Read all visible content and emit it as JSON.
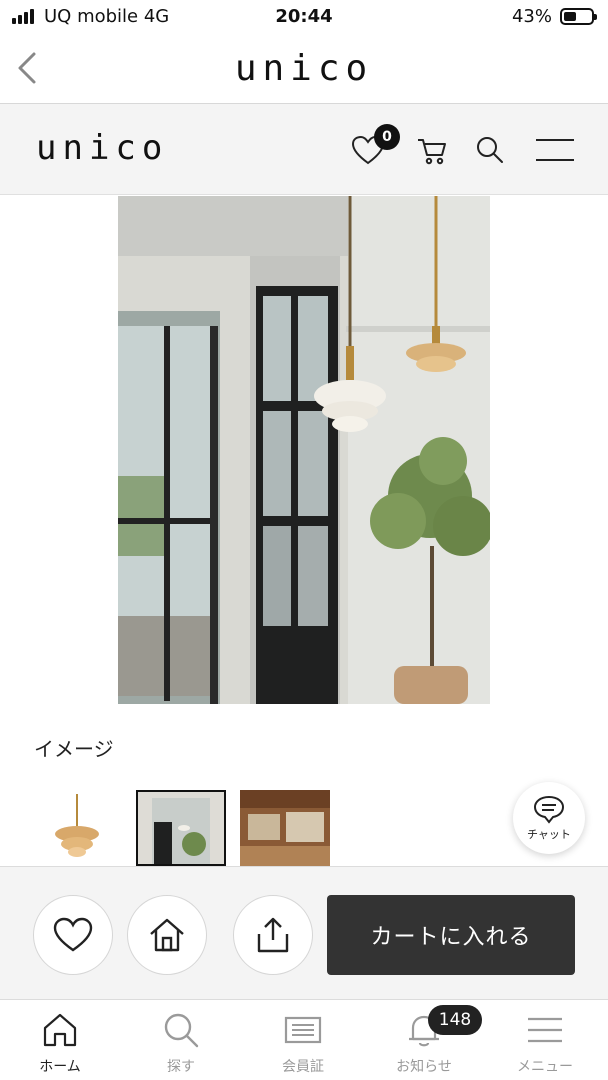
{
  "status_bar": {
    "carrier": "UQ mobile  4G",
    "time": "20:44",
    "battery": "43%"
  },
  "app_header": {
    "title": "unico"
  },
  "site_header": {
    "logo": "unico",
    "favorites_count": "0"
  },
  "product": {
    "image_caption": "イメージ"
  },
  "chat": {
    "label": "チャット"
  },
  "actions": {
    "cart_label": "カートに入れる"
  },
  "tab_bar": {
    "items": [
      {
        "label": "ホーム",
        "icon": "home-icon"
      },
      {
        "label": "探す",
        "icon": "search-icon"
      },
      {
        "label": "会員証",
        "icon": "member-card-icon"
      },
      {
        "label": "お知らせ",
        "icon": "bell-icon"
      },
      {
        "label": "メニュー",
        "icon": "menu-icon"
      }
    ],
    "notice_badge": "148"
  }
}
